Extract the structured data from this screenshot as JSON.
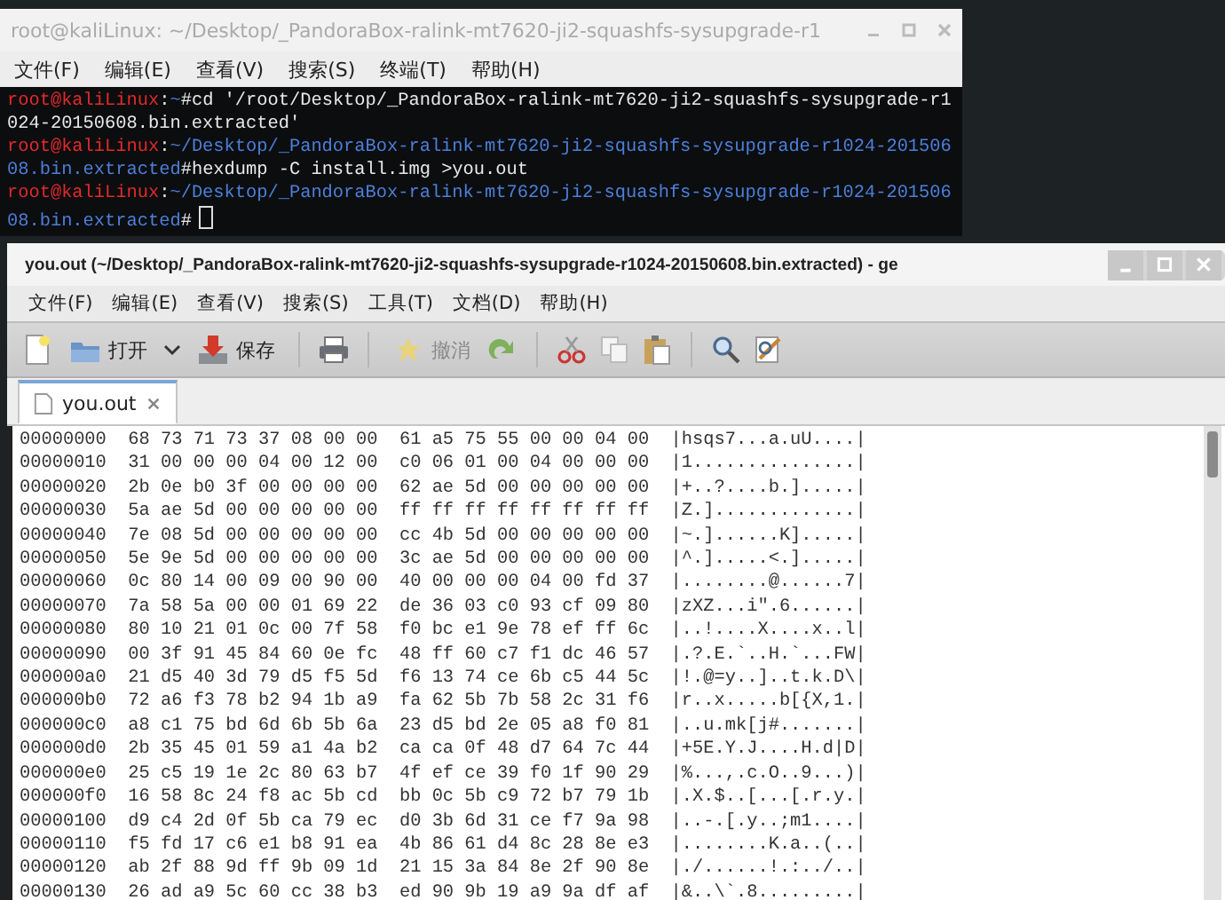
{
  "terminal": {
    "title": "root@kaliLinux: ~/Desktop/_PandoraBox-ralink-mt7620-ji2-squashfs-sysupgrade-r1",
    "menu": [
      "文件(F)",
      "编辑(E)",
      "查看(V)",
      "搜索(S)",
      "终端(T)",
      "帮助(H)"
    ],
    "lines": [
      {
        "user": "root@kaliLinux",
        "separator": ":",
        "path": "~",
        "sign": "#",
        "command": "cd '/root/Desktop/_PandoraBox-ralink-mt7620-ji2-squashfs-sysupgrade-r1024-20150608.bin.extracted'",
        "cursor": false
      },
      {
        "user": "root@kaliLinux",
        "separator": ":",
        "path": "~/Desktop/_PandoraBox-ralink-mt7620-ji2-squashfs-sysupgrade-r1024-20150608.bin.extracted",
        "sign": "#",
        "command": "hexdump -C install.img >you.out",
        "cursor": false
      },
      {
        "user": "root@kaliLinux",
        "separator": ":",
        "path": "~/Desktop/_PandoraBox-ralink-mt7620-ji2-squashfs-sysupgrade-r1024-20150608.bin.extracted",
        "sign": "#",
        "cursor": true
      }
    ]
  },
  "editor": {
    "title": "you.out (~/Desktop/_PandoraBox-ralink-mt7620-ji2-squashfs-sysupgrade-r1024-20150608.bin.extracted) - ge",
    "menu": [
      "文件(F)",
      "编辑(E)",
      "查看(V)",
      "搜索(S)",
      "工具(T)",
      "文档(D)",
      "帮助(H)"
    ],
    "toolbar": {
      "open": "打开",
      "save": "保存",
      "undo": {
        "label": "撤消",
        "disabled": true
      }
    },
    "tabs": [
      {
        "label": "you.out",
        "selected": true
      }
    ],
    "lines": [
      "00000000  68 73 71 73 37 08 00 00  61 a5 75 55 00 00 04 00  |hsqs7...a.uU....|",
      "00000010  31 00 00 00 04 00 12 00  c0 06 01 00 04 00 00 00  |1...............|",
      "00000020  2b 0e b0 3f 00 00 00 00  62 ae 5d 00 00 00 00 00  |+..?....b.].....|",
      "00000030  5a ae 5d 00 00 00 00 00  ff ff ff ff ff ff ff ff  |Z.].............|",
      "00000040  7e 08 5d 00 00 00 00 00  cc 4b 5d 00 00 00 00 00  |~.]......K].....|",
      "00000050  5e 9e 5d 00 00 00 00 00  3c ae 5d 00 00 00 00 00  |^.].....<.].....|",
      "00000060  0c 80 14 00 09 00 90 00  40 00 00 00 04 00 fd 37  |........@......7|",
      "00000070  7a 58 5a 00 00 01 69 22  de 36 03 c0 93 cf 09 80  |zXZ...i\".6......|",
      "00000080  80 10 21 01 0c 00 7f 58  f0 bc e1 9e 78 ef ff 6c  |..!....X....x..l|",
      "00000090  00 3f 91 45 84 60 0e fc  48 ff 60 c7 f1 dc 46 57  |.?.E.`..H.`...FW|",
      "000000a0  21 d5 40 3d 79 d5 f5 5d  f6 13 74 ce 6b c5 44 5c  |!.@=y..]..t.k.D\\|",
      "000000b0  72 a6 f3 78 b2 94 1b a9  fa 62 5b 7b 58 2c 31 f6  |r..x.....b[{X,1.|",
      "000000c0  a8 c1 75 bd 6d 6b 5b 6a  23 d5 bd 2e 05 a8 f0 81  |..u.mk[j#.......|",
      "000000d0  2b 35 45 01 59 a1 4a b2  ca ca 0f 48 d7 64 7c 44  |+5E.Y.J....H.d|D|",
      "000000e0  25 c5 19 1e 2c 80 63 b7  4f ef ce 39 f0 1f 90 29  |%...,.c.O..9...)|",
      "000000f0  16 58 8c 24 f8 ac 5b cd  bb 0c 5b c9 72 b7 79 1b  |.X.$..[...[.r.y.|",
      "00000100  d9 c4 2d 0f 5b ca 79 ec  d0 3b 6d 31 ce f7 9a 98  |..-.[.y..;m1....|",
      "00000110  f5 fd 17 c6 e1 b8 91 ea  4b 86 61 d4 8c 28 8e e3  |........K.a..(..|",
      "00000120  ab 2f 88 9d ff 9b 09 1d  21 15 3a 84 8e 2f 90 8e  |./......!.:../..|",
      "00000130  26 ad a9 5c 60 cc 38 b3  ed 90 9b 19 a9 9a df af  |&..\\`.8.........|"
    ]
  }
}
